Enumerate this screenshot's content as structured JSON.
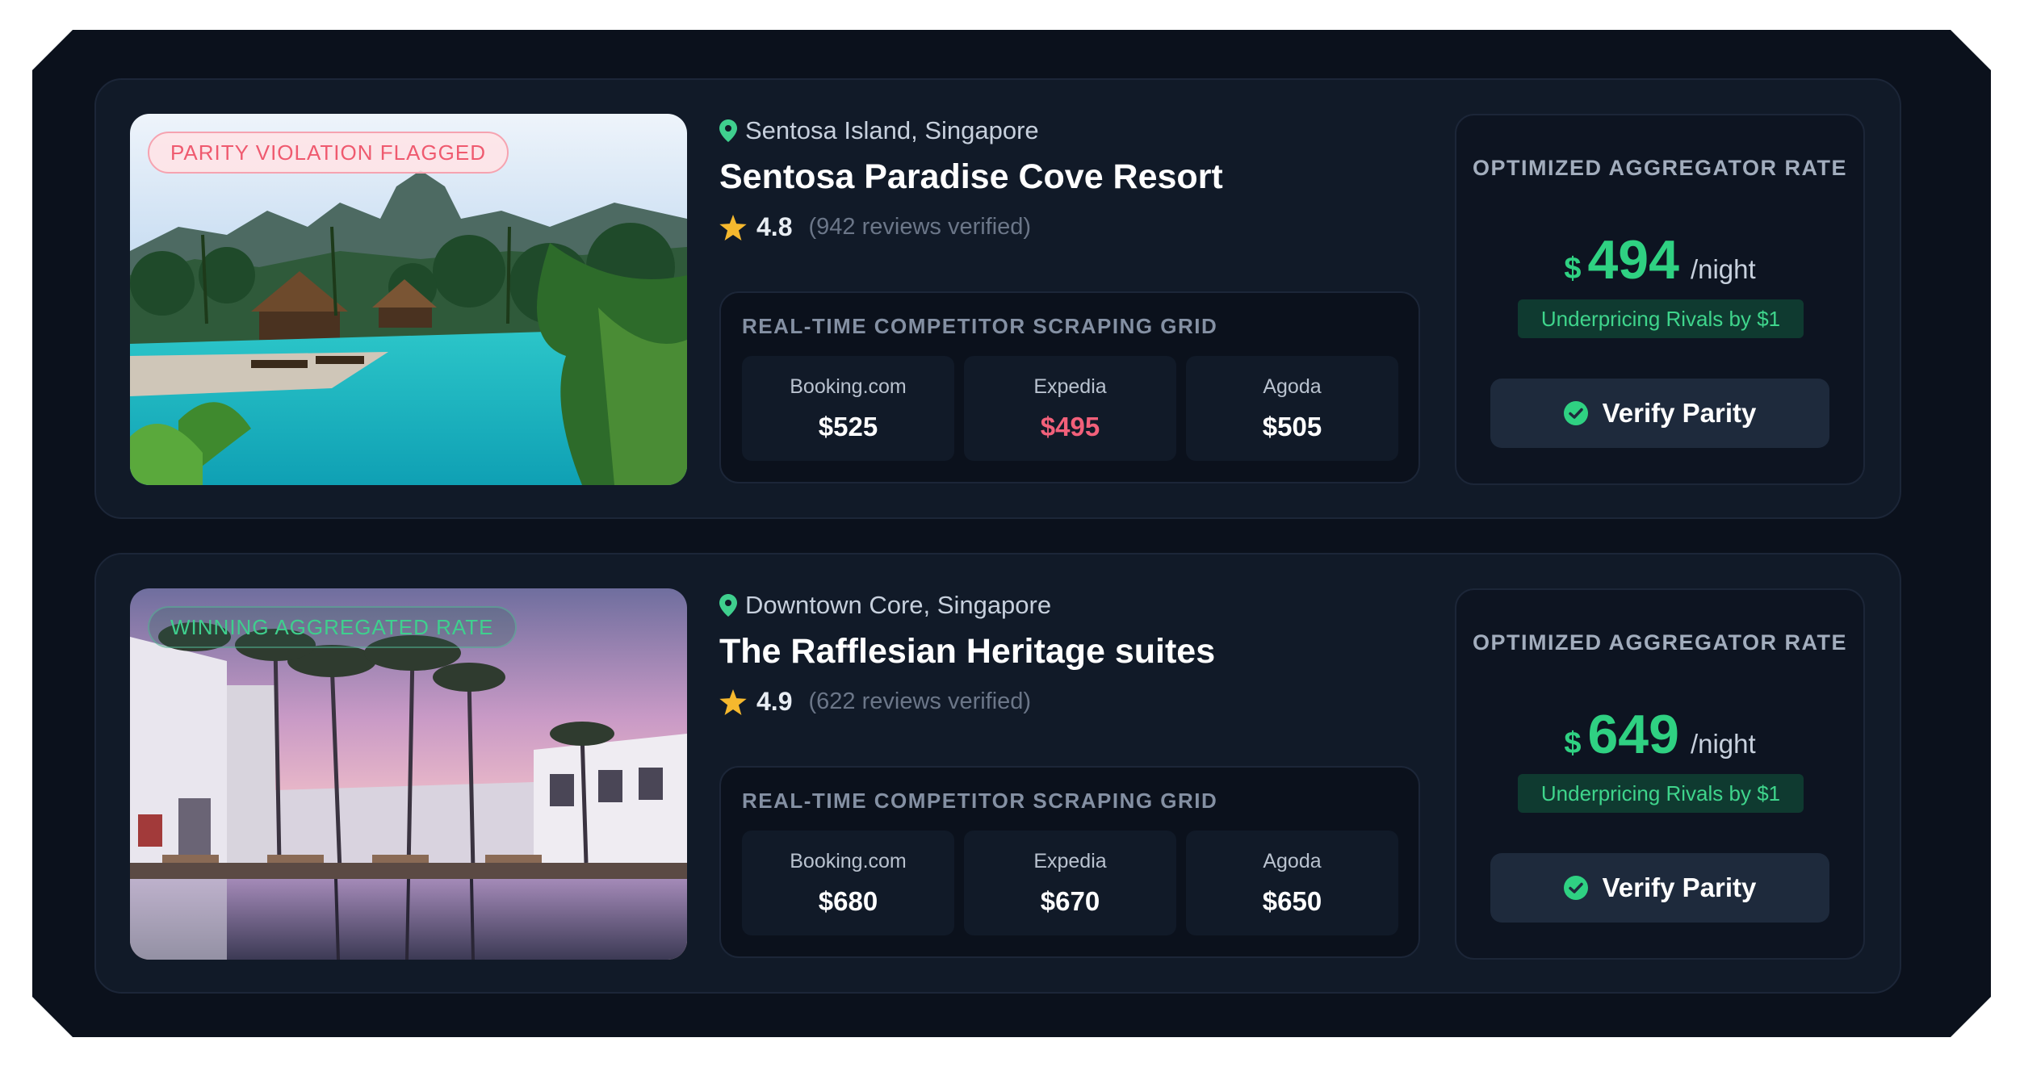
{
  "colors": {
    "background": "#0b111c",
    "card": "#111a28",
    "accent_green": "#2fd182",
    "alert_red": "#f2607a",
    "location_pin": "#3fcf8e",
    "star": "#f5b82e"
  },
  "listings": [
    {
      "badge": "PARITY VIOLATION FLAGGED",
      "badge_type": "violation",
      "location": "Sentosa Island, Singapore",
      "name": "Sentosa Paradise Cove Resort",
      "rating": "4.8",
      "reviews": "(942 reviews verified)",
      "grid_title": "REAL-TIME COMPETITOR SCRAPING GRID",
      "competitors": [
        {
          "source": "Booking.com",
          "price": "$525"
        },
        {
          "source": "Expedia",
          "price": "$495",
          "highlight": true
        },
        {
          "source": "Agoda",
          "price": "$505"
        }
      ],
      "rate_label": "OPTIMIZED AGGREGATOR RATE",
      "currency": "$",
      "rate": "494",
      "per_night": "/night",
      "underpricing": "Underpricing Rivals by $1",
      "verify_label": "Verify Parity",
      "image": "tropical-resort-pool-photo"
    },
    {
      "badge": "WINNING AGGREGATED RATE",
      "badge_type": "winning",
      "location": "Downtown Core, Singapore",
      "name": "The Rafflesian Heritage suites",
      "rating": "4.9",
      "reviews": "(622 reviews verified)",
      "grid_title": "REAL-TIME COMPETITOR SCRAPING GRID",
      "competitors": [
        {
          "source": "Booking.com",
          "price": "$680"
        },
        {
          "source": "Expedia",
          "price": "$670"
        },
        {
          "source": "Agoda",
          "price": "$650"
        }
      ],
      "rate_label": "OPTIMIZED AGGREGATOR RATE",
      "currency": "$",
      "rate": "649",
      "per_night": "/night",
      "underpricing": "Underpricing Rivals by $1",
      "verify_label": "Verify Parity",
      "image": "palm-hotel-sunset-photo"
    }
  ]
}
